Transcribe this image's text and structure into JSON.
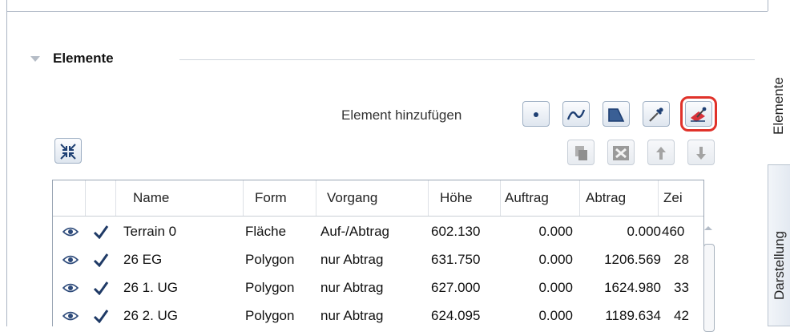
{
  "section": {
    "title": "Elemente"
  },
  "toolbar": {
    "add_label": "Element hinzufügen",
    "add_buttons": [
      {
        "icon": "point-element-icon"
      },
      {
        "icon": "line-element-icon"
      },
      {
        "icon": "area-element-icon"
      },
      {
        "icon": "pipette-icon"
      },
      {
        "icon": "add-from-existing-icon",
        "highlighted": true
      }
    ],
    "edit_buttons": [
      {
        "icon": "copy-icon"
      },
      {
        "icon": "delete-icon"
      },
      {
        "icon": "move-up-icon"
      },
      {
        "icon": "move-down-icon"
      }
    ],
    "collapse_icon": "collapse-all-icon"
  },
  "table": {
    "columns": [
      "Name",
      "Form",
      "Vorgang",
      "Höhe",
      "Auftrag",
      "Abtrag",
      "Zei"
    ],
    "rows": [
      {
        "name": "Terrain 0",
        "form": "Fläche",
        "vorgang": "Auf-/Abtrag",
        "hoehe": "602.130",
        "auftrag": "0.000",
        "abtrag": "0.000",
        "zei": "460"
      },
      {
        "name": "26 EG",
        "form": "Polygon",
        "vorgang": "nur Abtrag",
        "hoehe": "631.750",
        "auftrag": "0.000",
        "abtrag": "1206.569",
        "zei": "28"
      },
      {
        "name": "26 1. UG",
        "form": "Polygon",
        "vorgang": "nur Abtrag",
        "hoehe": "627.000",
        "auftrag": "0.000",
        "abtrag": "1624.980",
        "zei": "33"
      },
      {
        "name": "26 2. UG",
        "form": "Polygon",
        "vorgang": "nur Abtrag",
        "hoehe": "624.095",
        "auftrag": "0.000",
        "abtrag": "1189.634",
        "zei": "42"
      }
    ]
  },
  "side_tabs": [
    "Elemente",
    "Darstellung"
  ],
  "colors": {
    "highlight": "#e0322a",
    "check": "#1f3a66",
    "eye": "#2d4a7a"
  }
}
